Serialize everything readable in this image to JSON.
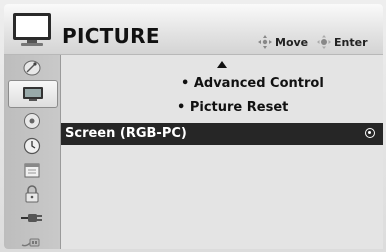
{
  "header": {
    "title": "PICTURE",
    "hint_move": "Move",
    "hint_enter": "Enter",
    "icon": "tv-icon"
  },
  "sidebar": {
    "items": [
      {
        "icon": "satellite-dish-icon"
      },
      {
        "icon": "picture-icon",
        "active": true
      },
      {
        "icon": "audio-disc-icon"
      },
      {
        "icon": "clock-icon"
      },
      {
        "icon": "calendar-icon"
      },
      {
        "icon": "lock-icon"
      },
      {
        "icon": "input-cable-icon"
      },
      {
        "icon": "usb-icon"
      }
    ]
  },
  "menu": {
    "items": [
      {
        "label": "• Advanced Control"
      },
      {
        "label": "• Picture Reset"
      }
    ],
    "selected": {
      "label": "Screen (RGB-PC)"
    }
  },
  "colors": {
    "selected_bg": "#262626",
    "background": "#e4e4e4"
  }
}
